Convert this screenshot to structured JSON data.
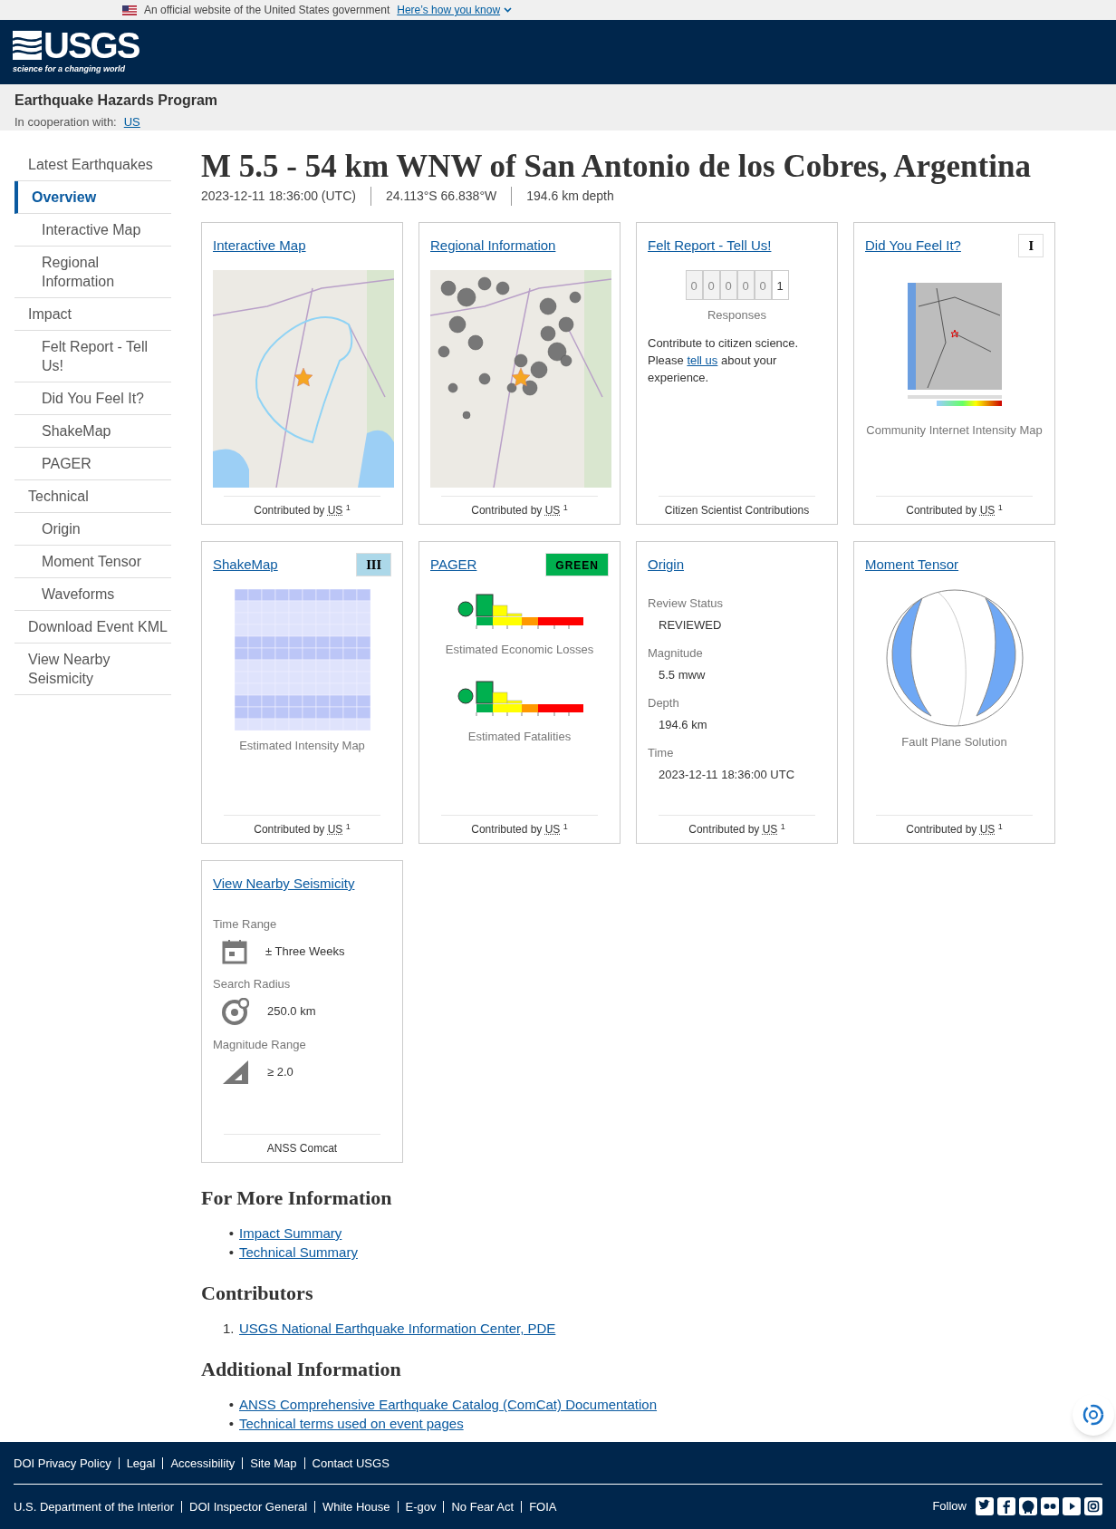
{
  "gov_banner": {
    "text": "An official website of the United States government",
    "link": "Here’s how you know"
  },
  "header": {
    "logo_text": "USGS",
    "tagline": "science for a changing world"
  },
  "program": {
    "title": "Earthquake Hazards Program",
    "cooperation_label": "In cooperation with:",
    "cooperation_link": "US"
  },
  "sidebar": {
    "items": [
      {
        "label": "Latest Earthquakes",
        "selected": false
      },
      {
        "label": "Overview",
        "selected": true,
        "children": [
          {
            "label": "Interactive Map",
            "selected": false
          },
          {
            "label": "Regional Information",
            "selected": false
          }
        ]
      },
      {
        "label": "Impact",
        "selected": false,
        "children": [
          {
            "label": "Felt Report - Tell Us!",
            "selected": false
          },
          {
            "label": "Did You Feel It?",
            "selected": false
          },
          {
            "label": "ShakeMap",
            "selected": false
          },
          {
            "label": "PAGER",
            "selected": false
          }
        ]
      },
      {
        "label": "Technical",
        "selected": false,
        "children": [
          {
            "label": "Origin",
            "selected": false
          },
          {
            "label": "Moment Tensor",
            "selected": false
          },
          {
            "label": "Waveforms",
            "selected": false
          }
        ]
      },
      {
        "label": "Download Event KML",
        "selected": false
      },
      {
        "label": "View Nearby Seismicity",
        "selected": false
      }
    ]
  },
  "event": {
    "title": "M 5.5 - 54 km WNW of San Antonio de los Cobres, Argentina",
    "time": "2023-12-11 18:36:00 (UTC)",
    "location": "24.113°S 66.838°W",
    "depth": "194.6 km depth"
  },
  "cards": [
    {
      "kind": "map",
      "title": "Interactive Map",
      "footer": {
        "text": "Contributed by",
        "source": "US",
        "note": "1"
      }
    },
    {
      "kind": "seismicity",
      "title": "Regional Information",
      "footer": {
        "text": "Contributed by",
        "source": "US",
        "note": "1"
      }
    },
    {
      "kind": "felt",
      "title": "Felt Report - Tell Us!",
      "digits": [
        "0",
        "0",
        "0",
        "0",
        "0",
        "1"
      ],
      "counter_label": "Responses",
      "text_before": "Contribute to citizen science. Please",
      "link": "tell us",
      "text_after": "about your experience.",
      "footer": {
        "text": "Citizen Scientist Contributions"
      }
    },
    {
      "kind": "dyfi",
      "title": "Did You Feel It?",
      "badge": {
        "text": "I",
        "color": "#ffffff"
      },
      "caption": "Community Internet Intensity Map",
      "footer": {
        "text": "Contributed by",
        "source": "US",
        "note": "1"
      }
    },
    {
      "kind": "shakemap",
      "title": "ShakeMap",
      "badge": {
        "text": "III",
        "color": "#acd8e9"
      },
      "caption": "Estimated Intensity Map",
      "footer": {
        "text": "Contributed by",
        "source": "US",
        "note": "1"
      }
    },
    {
      "kind": "pager",
      "title": "PAGER",
      "badge": {
        "text": "GREEN",
        "color": "#00b04f"
      },
      "graphs": [
        {
          "caption": "Estimated Economic Losses"
        },
        {
          "caption": "Estimated Fatalities"
        }
      ],
      "footer": {
        "text": "Contributed by",
        "source": "US",
        "note": "1"
      }
    },
    {
      "kind": "origin",
      "title": "Origin",
      "fields": [
        {
          "label": "Review Status",
          "value": "REVIEWED"
        },
        {
          "label": "Magnitude",
          "value": "5.5 mww"
        },
        {
          "label": "Depth",
          "value": "194.6 km"
        },
        {
          "label": "Time",
          "value": "2023-12-11 18:36:00 UTC"
        }
      ],
      "footer": {
        "text": "Contributed by",
        "source": "US",
        "note": "1"
      }
    },
    {
      "kind": "tensor",
      "title": "Moment Tensor",
      "caption": "Fault Plane Solution",
      "footer": {
        "text": "Contributed by",
        "source": "US",
        "note": "1"
      }
    },
    {
      "kind": "nearby",
      "title": "View Nearby Seismicity",
      "rows": [
        {
          "kind": "calendar",
          "label": "Time Range",
          "value": "± Three Weeks"
        },
        {
          "kind": "radius",
          "label": "Search Radius",
          "value": "250.0 km"
        },
        {
          "kind": "magnitude",
          "label": "Magnitude Range",
          "value": "≥ 2.0"
        }
      ],
      "footer": {
        "text": "ANSS Comcat"
      }
    }
  ],
  "more_info": {
    "heading": "For More Information",
    "links": [
      {
        "marker": "•",
        "text": "Impact Summary"
      },
      {
        "marker": "•",
        "text": "Technical Summary"
      }
    ]
  },
  "contributors": {
    "heading": "Contributors",
    "items": [
      {
        "marker": "1.",
        "text": "USGS National Earthquake Information Center, PDE"
      }
    ]
  },
  "additional": {
    "heading": "Additional Information",
    "links": [
      {
        "marker": "•",
        "text": "ANSS Comprehensive Earthquake Catalog (ComCat) Documentation"
      },
      {
        "marker": "•",
        "text": "Technical terms used on event pages"
      }
    ]
  },
  "footer": {
    "top_links": [
      "DOI Privacy Policy",
      "Legal",
      "Accessibility",
      "Site Map",
      "Contact USGS"
    ],
    "bottom_links": [
      "U.S. Department of the Interior",
      "DOI Inspector General",
      "White House",
      "E-gov",
      "No Fear Act",
      "FOIA"
    ],
    "follow_label": "Follow"
  }
}
